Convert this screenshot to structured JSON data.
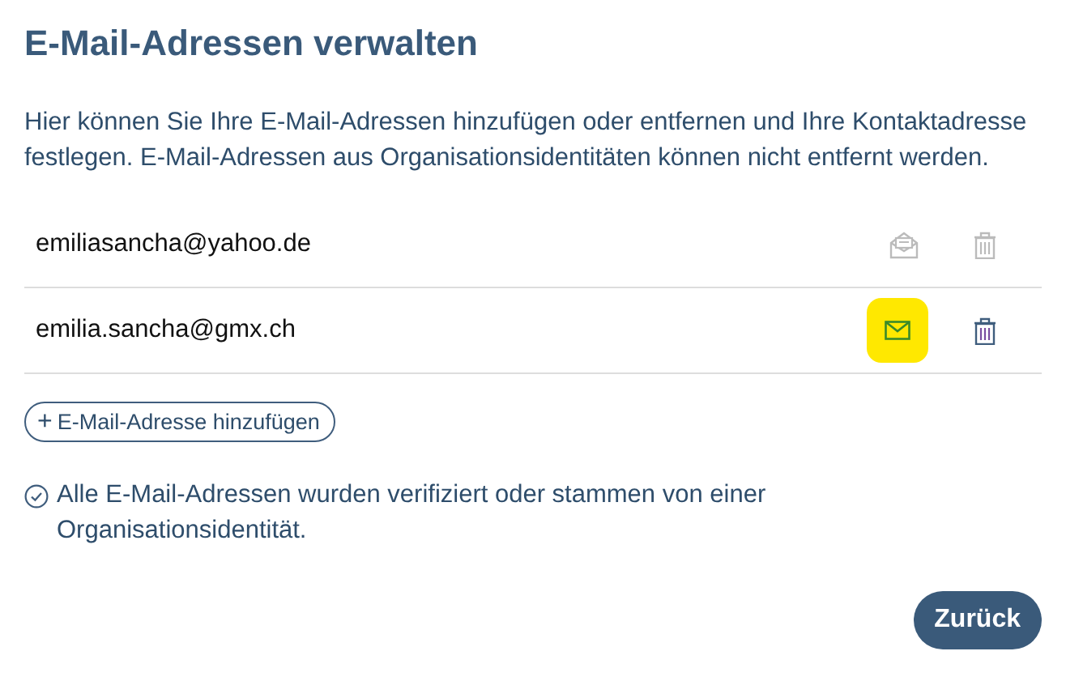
{
  "title": "E-Mail-Adressen verwalten",
  "intro": "Hier können Sie Ihre E-Mail-Adressen hinzufügen oder entfernen und Ihre Kontaktadresse festlegen. E-Mail-Adressen aus Organisationsidentitäten können nicht entfernt werden.",
  "addresses": [
    {
      "email": "emiliasancha@yahoo.de",
      "contact": false,
      "highlighted": false
    },
    {
      "email": "emilia.sancha@gmx.ch",
      "contact": true,
      "highlighted": true
    }
  ],
  "add_button": {
    "icon": "+",
    "label": "E-Mail-Adresse hinzufügen"
  },
  "notice": "Alle E-Mail-Adressen wurden verifiziert oder stammen von einer Organisationsidentität.",
  "back_button": "Zurück"
}
